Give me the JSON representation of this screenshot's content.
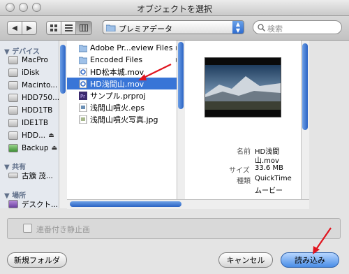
{
  "window": {
    "title": "オブジェクトを選択"
  },
  "toolbar": {
    "back_icon": "back-arrow-icon",
    "forward_icon": "forward-arrow-icon",
    "view_icons": [
      "icon-view-icon",
      "list-view-icon",
      "column-view-icon"
    ],
    "location": "プレミアデータ",
    "search_placeholder": "検索"
  },
  "sidebar": {
    "devices_label": "デバイス",
    "devices": [
      {
        "label": "MacPro",
        "eject": false
      },
      {
        "label": "iDisk",
        "eject": false
      },
      {
        "label": "Macinto...",
        "eject": false
      },
      {
        "label": "HDD750...",
        "eject": false
      },
      {
        "label": "HDD1TB",
        "eject": false
      },
      {
        "label": "IDE1TB",
        "eject": false
      },
      {
        "label": "HDD...",
        "eject": true
      },
      {
        "label": "Backup",
        "eject": true
      }
    ],
    "shared_label": "共有",
    "shared": [
      {
        "label": "古籏 茂..."
      }
    ],
    "places_label": "場所",
    "places": [
      {
        "label": "デスクト..."
      }
    ],
    "eject_glyph": "⏏"
  },
  "files": [
    {
      "name": "Adobe Pr...eview Files",
      "type": "folder",
      "chevron": true
    },
    {
      "name": "Encoded Files",
      "type": "folder",
      "chevron": true
    },
    {
      "name": "HD松本城.mov",
      "type": "movie"
    },
    {
      "name": "HD浅間山.mov",
      "type": "movie",
      "selected": true
    },
    {
      "name": "サンプル.prproj",
      "type": "premiere"
    },
    {
      "name": "浅間山噴火.eps",
      "type": "document"
    },
    {
      "name": "浅間山噴火写真.jpg",
      "type": "image"
    }
  ],
  "preview": {
    "name_label": "名前",
    "name_value_1": "HD浅間",
    "name_value_2": "山.mov",
    "size_label": "サイズ",
    "size_value": "33.6 MB",
    "kind_label": "種類",
    "kind_value_1": "QuickTime",
    "kind_value_2": "ムービー"
  },
  "options": {
    "checkbox_label": "連番付き静止画",
    "checked": false
  },
  "buttons": {
    "new_folder": "新規フォルダ",
    "cancel": "キャンセル",
    "import": "読み込み"
  },
  "colors": {
    "selection": "#3875d7",
    "annotation_arrow": "#e0141e"
  }
}
